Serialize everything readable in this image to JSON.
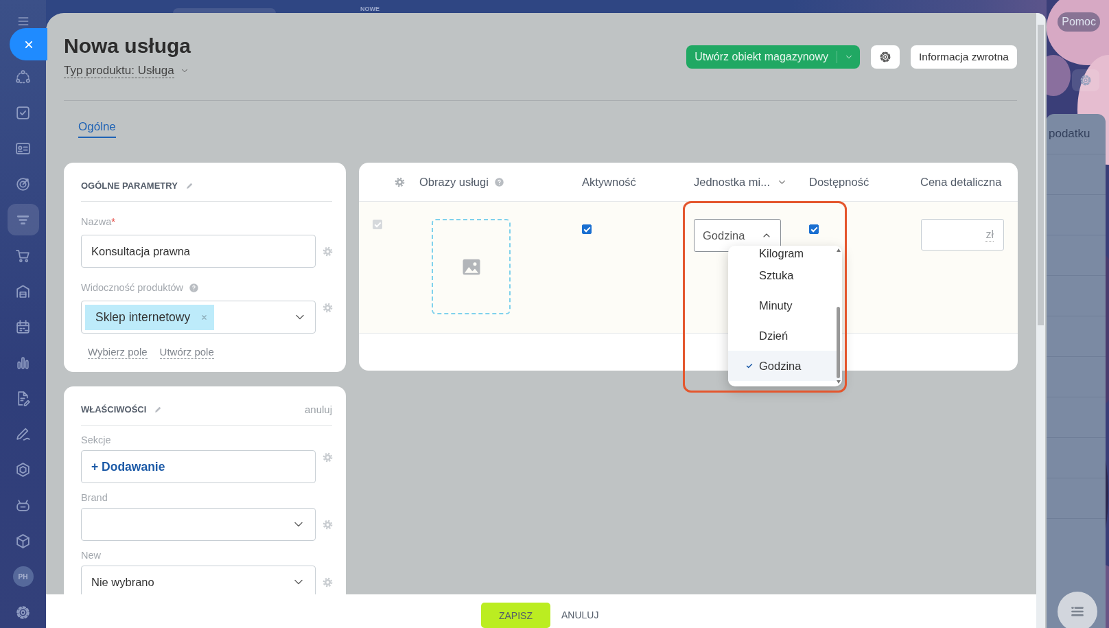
{
  "desktop": {
    "badge": "NOWE",
    "help_button": "Pomoc",
    "panel_text": "podatku"
  },
  "sidebar": {
    "items": [
      {
        "kind": "nodes",
        "selected": false
      },
      {
        "kind": "tasks",
        "selected": false
      },
      {
        "kind": "contacts",
        "selected": false
      },
      {
        "kind": "target",
        "selected": false
      },
      {
        "kind": "funnel",
        "selected": true
      },
      {
        "kind": "cart",
        "selected": false
      },
      {
        "kind": "store",
        "selected": false
      },
      {
        "kind": "calendar",
        "selected": false
      },
      {
        "kind": "chart",
        "selected": false
      },
      {
        "kind": "document",
        "selected": false
      },
      {
        "kind": "pen",
        "selected": false
      },
      {
        "kind": "hexagon",
        "selected": false
      },
      {
        "kind": "robot",
        "selected": false
      },
      {
        "kind": "cube",
        "selected": false
      },
      {
        "kind": "avatar",
        "selected": false,
        "label": "PH"
      },
      {
        "kind": "settings",
        "selected": false
      }
    ]
  },
  "header": {
    "title": "Nowa usługa",
    "product_type": "Typ produktu: Usługa",
    "create_button": "Utwórz obiekt magazynowy",
    "feedback_button": "Informacja zwrotna"
  },
  "tabs": [
    {
      "label": "Ogólne",
      "selected": true
    }
  ],
  "general_card": {
    "title": "OGÓLNE PARAMETRY",
    "fields": [
      {
        "kind": "text",
        "label": "Nazwa",
        "required_mark": "*",
        "help": false,
        "value": "Konsultacja prawna"
      },
      {
        "kind": "tags",
        "label": "Widoczność produktów",
        "help": true,
        "tags": [
          "Sklep internetowy"
        ]
      }
    ],
    "links": [
      "Wybierz pole",
      "Utwórz pole"
    ]
  },
  "properties_card": {
    "title": "WŁAŚCIWOŚCI",
    "action": "anuluj",
    "fields": [
      {
        "kind": "add",
        "label": "Sekcje",
        "help": false,
        "value": "+ Dodawanie"
      },
      {
        "kind": "select",
        "label": "Brand",
        "help": false
      },
      {
        "kind": "select",
        "label": "New",
        "help": false,
        "value": "Nie wybrano"
      }
    ]
  },
  "table": {
    "columns": [
      {
        "label": "Obrazy usługi",
        "help": true,
        "menu": false
      },
      {
        "label": "Aktywność",
        "help": false,
        "menu": false
      },
      {
        "label": "Jednostka mi...",
        "help": false,
        "menu": true
      },
      {
        "label": "Dostępność",
        "help": false,
        "menu": false
      },
      {
        "label": "Cena detaliczna",
        "help": false,
        "menu": false
      }
    ],
    "rows": [
      {
        "selected": true,
        "disabled": true,
        "active": true,
        "unit": "Godzina",
        "available": true,
        "currency": "zł"
      }
    ]
  },
  "unit_dropdown": {
    "open": true,
    "options": [
      {
        "label": "Kilogram",
        "selected": false
      },
      {
        "label": "Sztuka",
        "selected": false
      },
      {
        "label": "Minuty",
        "selected": false
      },
      {
        "label": "Dzień",
        "selected": false
      },
      {
        "label": "Godzina",
        "selected": true
      }
    ]
  },
  "footer": {
    "save": "ZAPISZ",
    "cancel": "ANULUJ"
  }
}
